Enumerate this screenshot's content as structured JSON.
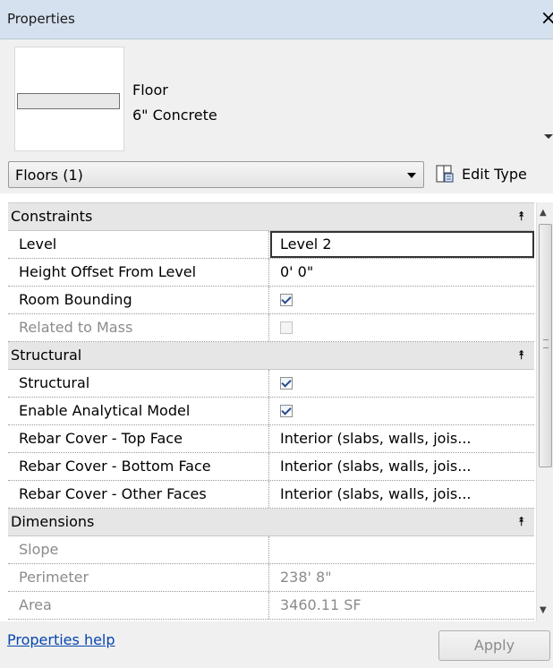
{
  "window": {
    "title": "Properties",
    "close_glyph": "×"
  },
  "type_selector": {
    "family": "Floor",
    "type_name": "6\" Concrete"
  },
  "filter": {
    "selected": "Floors (1)",
    "edit_type_label": "Edit Type"
  },
  "groups": {
    "constraints": {
      "label": "Constraints",
      "level": {
        "name": "Level",
        "value": "Level 2"
      },
      "height_offset": {
        "name": "Height Offset From Level",
        "value": "0'  0\""
      },
      "room_bounding": {
        "name": "Room Bounding",
        "checked": true
      },
      "related_to_mass": {
        "name": "Related to Mass",
        "checked": false
      }
    },
    "structural": {
      "label": "Structural",
      "structural": {
        "name": "Structural",
        "checked": true
      },
      "enable_analytical": {
        "name": "Enable Analytical Model",
        "checked": true
      },
      "rebar_top": {
        "name": "Rebar Cover - Top Face",
        "value": "Interior (slabs, walls, jois..."
      },
      "rebar_bottom": {
        "name": "Rebar Cover - Bottom Face",
        "value": "Interior (slabs, walls, jois..."
      },
      "rebar_other": {
        "name": "Rebar Cover - Other Faces",
        "value": "Interior (slabs, walls, jois..."
      }
    },
    "dimensions": {
      "label": "Dimensions",
      "slope": {
        "name": "Slope",
        "value": ""
      },
      "perimeter": {
        "name": "Perimeter",
        "value": "238'  8\""
      },
      "area": {
        "name": "Area",
        "value": "3460.11 SF"
      }
    }
  },
  "footer": {
    "help_label": "Properties help",
    "apply_label": "Apply"
  },
  "colors": {
    "titlebar": "#d6e1ef",
    "group_header": "#e6e6e6",
    "link": "#0645ad",
    "disabled_text": "#8b8b8b"
  },
  "icons": {
    "close": "close-icon",
    "edit_type": "edit-type-icon",
    "collapse": "collapse-icon",
    "dropdown": "chevron-down-icon"
  }
}
